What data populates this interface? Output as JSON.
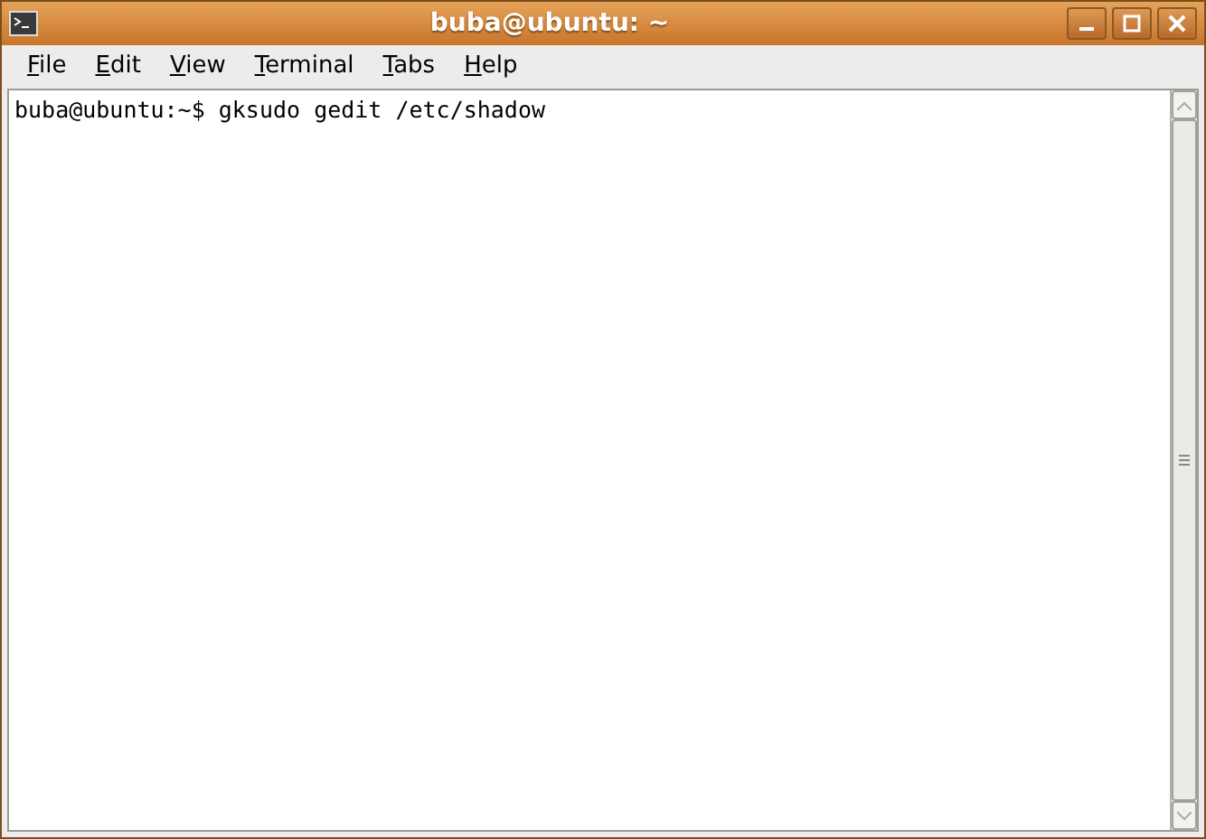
{
  "window": {
    "title": "buba@ubuntu: ~"
  },
  "menu": [
    "File",
    "Edit",
    "View",
    "Terminal",
    "Tabs",
    "Help"
  ],
  "terminal": {
    "lines": [
      "buba@ubuntu:~$ gksudo gedit /etc/shadow"
    ]
  }
}
